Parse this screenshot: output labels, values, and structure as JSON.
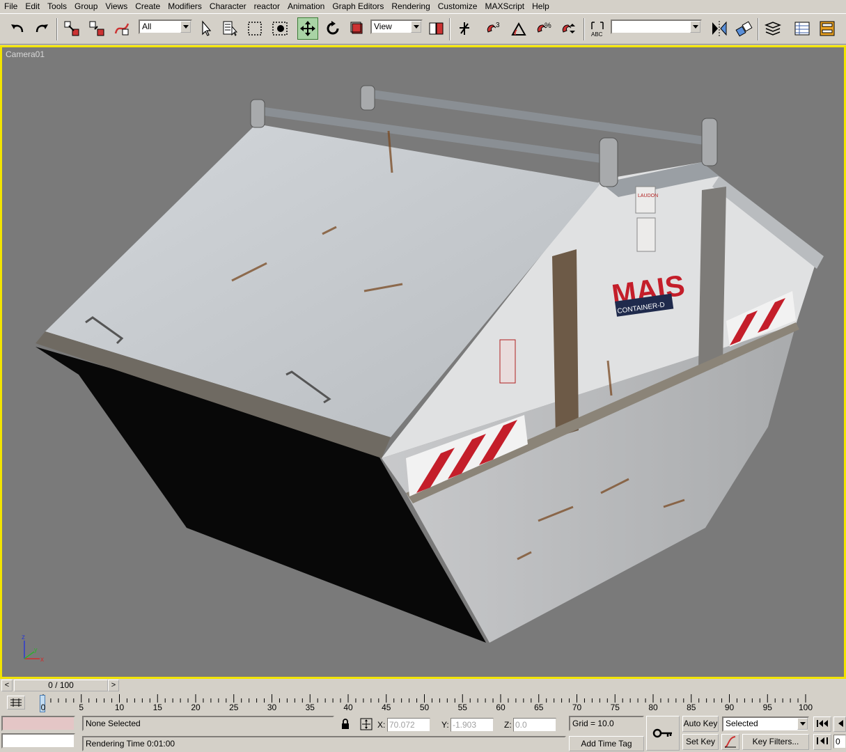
{
  "menu": [
    "File",
    "Edit",
    "Tools",
    "Group",
    "Views",
    "Create",
    "Modifiers",
    "Character",
    "reactor",
    "Animation",
    "Graph Editors",
    "Rendering",
    "Customize",
    "MAXScript",
    "Help"
  ],
  "toolbar": {
    "selection_filter": "All",
    "reference_coord": "View",
    "named_selection": ""
  },
  "viewport": {
    "label": "Camera01",
    "axis": {
      "z": "z",
      "x": "x",
      "y": "y"
    },
    "model_text": {
      "brand": "MAIS",
      "sub": "CONTAINER-D",
      "sticker": "LAUDON"
    },
    "border_color": "#f2e400"
  },
  "timeslider": {
    "frame": "0 / 100",
    "prev": "<",
    "next": ">"
  },
  "trackbar": {
    "ticks": [
      "0",
      "5",
      "10",
      "15",
      "20",
      "25",
      "30",
      "35",
      "40",
      "45",
      "50",
      "55",
      "60",
      "65",
      "70",
      "75",
      "80",
      "85",
      "90",
      "95",
      "100"
    ]
  },
  "status": {
    "selection": "None Selected",
    "prompt": "Rendering Time  0:01:00",
    "x_label": "X:",
    "x_value": "70.072",
    "y_label": "Y:",
    "y_value": "-1.903",
    "z_label": "Z:",
    "z_value": "0.0",
    "grid": "Grid = 10.0",
    "add_time_tag": "Add Time Tag",
    "auto_key": "Auto Key",
    "set_key": "Set Key",
    "key_mode": "Selected",
    "key_filters": "Key Filters...",
    "frame_field": "0"
  }
}
